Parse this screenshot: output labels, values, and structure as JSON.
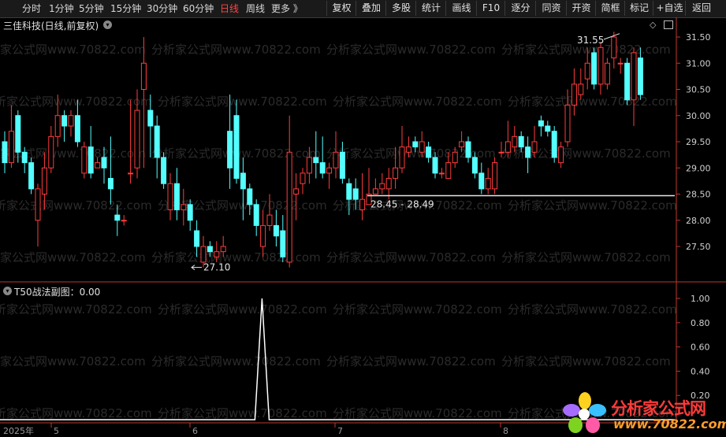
{
  "toolbar": {
    "periods": [
      "分时",
      "1分钟",
      "5分钟",
      "15分钟",
      "30分钟",
      "60分钟",
      "日线",
      "周线",
      "更多 》"
    ],
    "active_period": "日线",
    "buttons": [
      "复权",
      "叠加",
      "多股",
      "统计",
      "画线",
      "F10",
      "逐分",
      "同资",
      "开资",
      "简框",
      "标记",
      "+自选",
      "返回"
    ]
  },
  "main_chart": {
    "title": "三佳科技(日线,前复权)",
    "annotations": {
      "high": "31.55",
      "low": "27.10",
      "range": "28.45 - 28.49"
    }
  },
  "sub_chart": {
    "title": "T50战法副图：0.00"
  },
  "watermark_text": "分析家公式网www.70822.com",
  "logo": {
    "text": "分析家公式网",
    "url": "www.70822.com"
  },
  "colors": {
    "up": "#ff3d3d",
    "down": "#54ffff",
    "axis": "#c0392b",
    "background": "#000000"
  },
  "chart_data": [
    {
      "type": "candlestick",
      "title": "三佳科技(日线,前复权)",
      "y_ticks": [
        "31.50",
        "31.00",
        "30.50",
        "30.00",
        "29.50",
        "29.00",
        "28.50",
        "28.00",
        "27.50"
      ],
      "ylim": [
        27.0,
        31.8
      ],
      "x_ticks": [
        "2025年",
        "5",
        "6",
        "7",
        "8"
      ],
      "candles": [
        [
          29.5,
          29.1,
          29.7,
          28.9
        ],
        [
          29.1,
          29.7,
          30.2,
          29.0
        ],
        [
          30.0,
          29.3,
          30.1,
          29.1
        ],
        [
          29.3,
          29.1,
          29.4,
          28.9
        ],
        [
          29.1,
          28.6,
          29.2,
          28.5
        ],
        [
          28.0,
          28.6,
          28.7,
          27.5
        ],
        [
          28.5,
          29.0,
          29.3,
          28.2
        ],
        [
          29.0,
          29.6,
          29.8,
          28.9
        ],
        [
          29.6,
          30.0,
          30.4,
          29.4
        ],
        [
          30.0,
          29.8,
          30.1,
          29.5
        ],
        [
          29.8,
          30.0,
          30.1,
          29.6
        ],
        [
          30.0,
          29.5,
          30.3,
          29.4
        ],
        [
          28.9,
          29.4,
          29.5,
          28.8
        ],
        [
          29.4,
          28.9,
          29.8,
          28.8
        ],
        [
          29.0,
          29.1,
          29.2,
          29.0
        ],
        [
          29.2,
          29.0,
          29.4,
          28.7
        ],
        [
          28.8,
          28.6,
          29.6,
          28.3
        ],
        [
          28.1,
          28.0,
          28.3,
          27.7
        ],
        [
          28.0,
          28.0,
          28.1,
          27.9
        ],
        [
          28.9,
          28.9,
          30.3,
          28.7
        ],
        [
          29.0,
          30.1,
          30.5,
          28.8
        ],
        [
          30.5,
          31.0,
          31.5,
          29.0
        ],
        [
          30.1,
          29.8,
          30.4,
          29.2
        ],
        [
          29.8,
          29.2,
          30.0,
          28.8
        ],
        [
          29.2,
          28.7,
          29.3,
          28.6
        ],
        [
          28.2,
          28.7,
          28.9,
          28.0
        ],
        [
          28.7,
          28.2,
          29.0,
          28.0
        ],
        [
          28.2,
          28.3,
          28.6,
          27.9
        ],
        [
          28.3,
          28.0,
          28.4,
          27.8
        ],
        [
          27.8,
          27.5,
          28.0,
          27.3
        ],
        [
          27.2,
          27.5,
          27.7,
          27.1
        ],
        [
          27.5,
          27.4,
          27.6,
          27.3
        ],
        [
          27.3,
          27.4,
          27.6,
          27.2
        ],
        [
          27.4,
          27.5,
          27.7,
          27.3
        ],
        [
          29.7,
          29.0,
          30.4,
          28.6
        ],
        [
          30.0,
          28.8,
          30.3,
          28.7
        ],
        [
          28.9,
          28.6,
          29.2,
          28.0
        ],
        [
          28.6,
          28.3,
          28.7,
          28.1
        ],
        [
          28.3,
          27.9,
          28.4,
          27.7
        ],
        [
          27.5,
          27.9,
          28.2,
          27.3
        ],
        [
          27.9,
          28.1,
          28.5,
          27.8
        ],
        [
          27.9,
          27.7,
          28.2,
          27.5
        ],
        [
          27.8,
          27.3,
          28.1,
          27.2
        ],
        [
          27.2,
          29.3,
          30.0,
          27.1
        ],
        [
          28.5,
          28.6,
          28.9,
          28.0
        ],
        [
          28.7,
          28.9,
          29.0,
          28.5
        ],
        [
          28.9,
          29.2,
          29.4,
          28.7
        ],
        [
          29.2,
          29.1,
          29.7,
          28.8
        ],
        [
          29.1,
          28.9,
          29.6,
          28.8
        ],
        [
          28.9,
          29.0,
          29.1,
          28.6
        ],
        [
          29.0,
          29.3,
          29.7,
          28.8
        ],
        [
          29.3,
          28.8,
          29.5,
          28.7
        ],
        [
          28.7,
          28.4,
          28.8,
          28.1
        ],
        [
          28.6,
          28.4,
          28.8,
          28.2
        ],
        [
          28.2,
          28.4,
          28.9,
          28.0
        ],
        [
          28.3,
          28.5,
          29.0,
          28.3
        ],
        [
          28.5,
          28.6,
          28.8,
          28.5
        ],
        [
          28.6,
          28.7,
          28.9,
          28.5
        ],
        [
          28.6,
          28.8,
          29.0,
          28.4
        ],
        [
          28.8,
          29.0,
          29.4,
          28.6
        ],
        [
          29.0,
          29.4,
          29.8,
          28.9
        ],
        [
          29.3,
          29.4,
          29.6,
          29.2
        ],
        [
          29.5,
          29.4,
          29.6,
          29.3
        ],
        [
          29.3,
          29.5,
          29.7,
          29.2
        ],
        [
          29.4,
          29.2,
          29.5,
          29.1
        ],
        [
          29.2,
          28.9,
          29.3,
          28.8
        ],
        [
          28.9,
          28.9,
          29.0,
          28.8
        ],
        [
          28.8,
          29.1,
          29.3,
          28.8
        ],
        [
          29.1,
          29.3,
          29.4,
          29.0
        ],
        [
          29.4,
          29.5,
          29.7,
          29.3
        ],
        [
          29.5,
          29.2,
          29.6,
          29.1
        ],
        [
          29.2,
          28.9,
          29.3,
          28.8
        ],
        [
          28.9,
          28.6,
          29.1,
          28.5
        ],
        [
          28.6,
          28.8,
          29.0,
          28.5
        ],
        [
          28.6,
          29.1,
          29.2,
          28.5
        ],
        [
          29.3,
          29.3,
          29.5,
          29.2
        ],
        [
          29.3,
          29.5,
          29.9,
          29.2
        ],
        [
          29.4,
          29.6,
          29.8,
          29.3
        ],
        [
          29.6,
          29.4,
          29.7,
          29.3
        ],
        [
          29.4,
          29.2,
          29.6,
          28.9
        ],
        [
          29.3,
          29.5,
          29.8,
          29.2
        ],
        [
          29.9,
          29.8,
          30.0,
          29.6
        ],
        [
          29.8,
          29.7,
          29.9,
          29.6
        ],
        [
          29.7,
          29.2,
          29.8,
          29.1
        ],
        [
          29.1,
          29.4,
          29.5,
          29.0
        ],
        [
          29.5,
          30.2,
          30.5,
          29.4
        ],
        [
          30.2,
          30.6,
          30.9,
          30.0
        ],
        [
          30.4,
          30.6,
          30.9,
          30.3
        ],
        [
          30.7,
          31.0,
          31.3,
          30.5
        ],
        [
          31.2,
          30.6,
          31.3,
          30.5
        ],
        [
          30.6,
          31.3,
          31.4,
          30.4
        ],
        [
          30.6,
          31.0,
          31.1,
          30.5
        ],
        [
          31.1,
          31.5,
          31.6,
          30.9
        ],
        [
          31.0,
          31.0,
          31.1,
          30.8
        ],
        [
          31.0,
          30.3,
          31.1,
          30.2
        ],
        [
          30.3,
          31.2,
          31.3,
          29.8
        ],
        [
          31.1,
          30.4,
          31.3,
          30.3
        ]
      ],
      "highlight_line": {
        "value": 28.47
      }
    },
    {
      "type": "line",
      "title": "T50战法副图：0.00",
      "y_ticks": [
        "1.00",
        "0.80",
        "0.60",
        "0.40",
        "0.20"
      ],
      "ylim": [
        0,
        1
      ],
      "signal": {
        "peak_index": 41,
        "peak_value": 1.0
      }
    }
  ]
}
